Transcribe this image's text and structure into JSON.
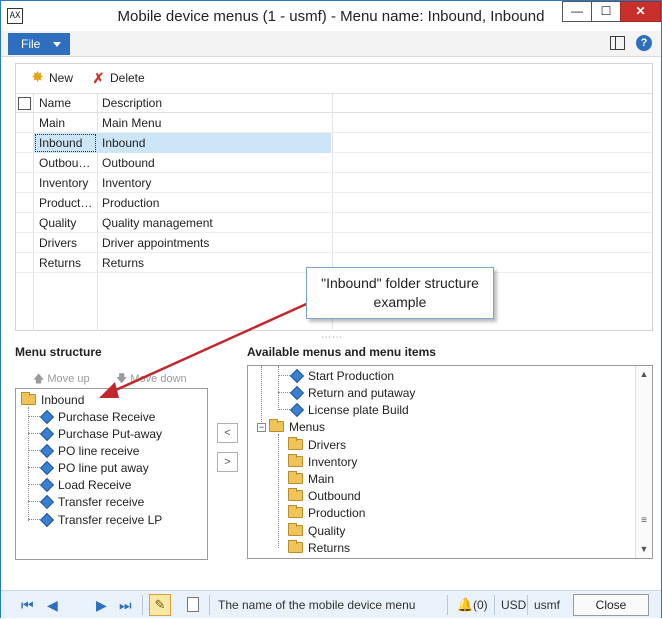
{
  "window": {
    "title": "Mobile device menus (1 - usmf) - Menu name: Inbound, Inbound",
    "app_icon_text": "AX",
    "min_glyph": "—",
    "max_glyph": "☐",
    "close_glyph": "✕"
  },
  "menubar": {
    "file_label": "File",
    "help_glyph": "?"
  },
  "toolbar": {
    "new_label": "New",
    "delete_label": "Delete",
    "new_glyph": "✸",
    "delete_glyph": "✗"
  },
  "grid": {
    "columns": [
      "Name",
      "Description"
    ],
    "rows": [
      {
        "name": "Main",
        "description": "Main Menu"
      },
      {
        "name": "Inbound",
        "description": "Inbound",
        "selected": true
      },
      {
        "name": "Outbou…",
        "description": "Outbound"
      },
      {
        "name": "Inventory",
        "description": "Inventory"
      },
      {
        "name": "Product…",
        "description": "Production"
      },
      {
        "name": "Quality",
        "description": "Quality management"
      },
      {
        "name": "Drivers",
        "description": "Driver appointments"
      },
      {
        "name": "Returns",
        "description": "Returns"
      }
    ]
  },
  "splitter_glyph": "⋯⋯",
  "menu_structure": {
    "label": "Menu structure",
    "move_up_label": "Move up",
    "move_down_label": "Move down",
    "root": "Inbound",
    "items": [
      "Purchase Receive",
      "Purchase Put-away",
      "PO line receive",
      "PO line put away",
      "Load Receive",
      "Transfer receive",
      "Transfer receive LP"
    ]
  },
  "transfer": {
    "left_glyph": "<",
    "right_glyph": ">"
  },
  "available": {
    "label": "Available menus and menu items",
    "items": [
      "Start Production",
      "Return and putaway",
      "License plate Build"
    ],
    "menus_label": "Menus",
    "menus_expander": "−",
    "menus": [
      "Drivers",
      "Inventory",
      "Main",
      "Outbound",
      "Production",
      "Quality",
      "Returns"
    ]
  },
  "scroll": {
    "up_glyph": "▲",
    "down_glyph": "▼",
    "grip_glyph": "≡"
  },
  "callout": {
    "line1": "\"Inbound\" folder structure",
    "line2": "example"
  },
  "statusbar": {
    "first_glyph": "⏮",
    "prev_glyph": "◀",
    "next_glyph": "▶",
    "last_glyph": "⏭",
    "edit_glyph": "✎",
    "help_text": "The name of the mobile device menu",
    "notifications": "(0)",
    "currency": "USD",
    "company": "usmf",
    "close_label": "Close"
  },
  "colors": {
    "accent": "#2e6fbd",
    "selection": "#cde6f7",
    "arrow": "#c1272d",
    "close": "#c7302b"
  }
}
